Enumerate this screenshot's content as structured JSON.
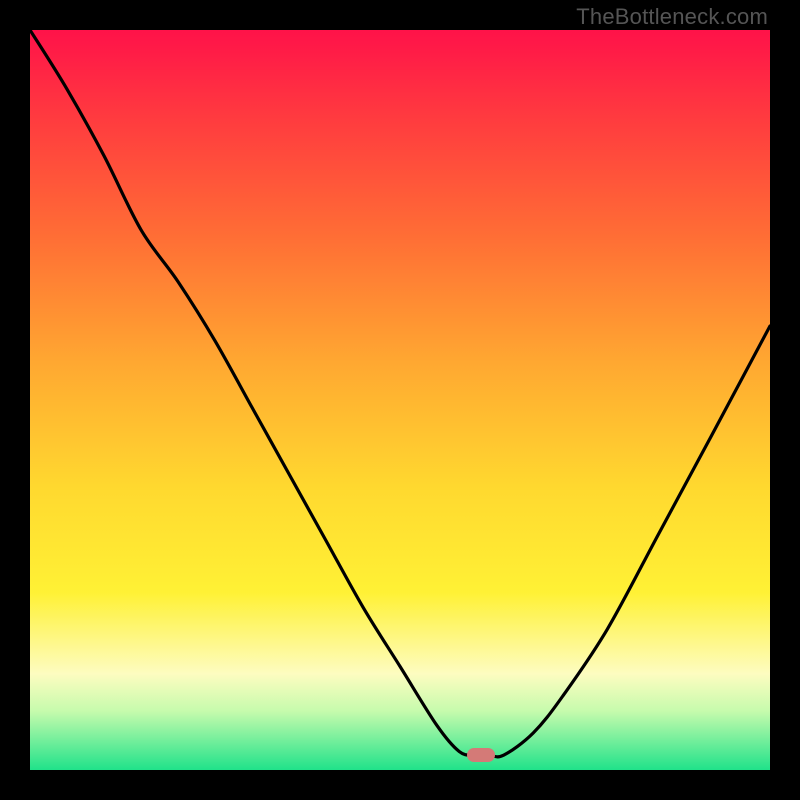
{
  "watermark": "TheBottleneck.com",
  "colors": {
    "frame": "#000000",
    "gradient_css": "linear-gradient(to bottom, #ff1249 0%, #ff3b3f 12%, #ff6e35 28%, #ffa831 45%, #ffd92f 62%, #fff135 76%, #fdfcc0 87%, #c7fbad 92%, #20e28a 100%)",
    "curve": "#000000",
    "marker": "#d47a77"
  },
  "chart_data": {
    "type": "line",
    "title": "",
    "xlabel": "",
    "ylabel": "",
    "xlim": [
      0,
      1
    ],
    "ylim": [
      0,
      1
    ],
    "series": [
      {
        "name": "bottleneck-curve",
        "x": [
          0.0,
          0.05,
          0.1,
          0.15,
          0.2,
          0.25,
          0.3,
          0.35,
          0.4,
          0.45,
          0.5,
          0.55,
          0.58,
          0.6,
          0.62,
          0.64,
          0.68,
          0.72,
          0.78,
          0.85,
          0.92,
          1.0
        ],
        "y": [
          1.0,
          0.92,
          0.83,
          0.73,
          0.66,
          0.58,
          0.49,
          0.4,
          0.31,
          0.22,
          0.14,
          0.06,
          0.025,
          0.02,
          0.02,
          0.02,
          0.05,
          0.1,
          0.19,
          0.32,
          0.45,
          0.6
        ]
      }
    ],
    "marker": {
      "x": 0.61,
      "y": 0.02
    }
  }
}
